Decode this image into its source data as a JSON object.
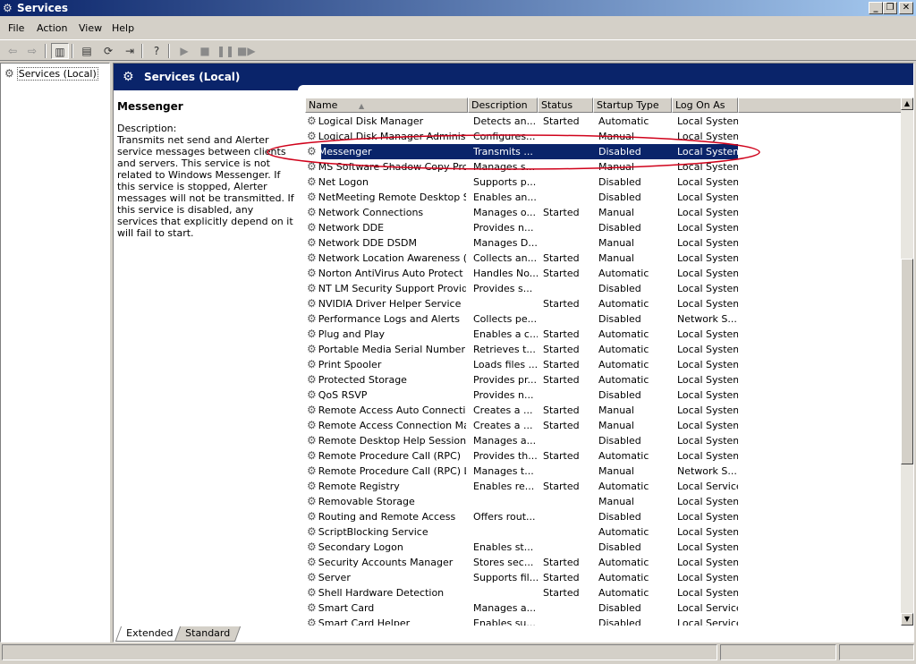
{
  "window": {
    "title": "Services",
    "min_glyph": "_",
    "max_glyph": "❐",
    "close_glyph": "✕"
  },
  "menu": [
    {
      "label": "File",
      "name": "menu-file"
    },
    {
      "label": "Action",
      "name": "menu-action"
    },
    {
      "label": "View",
      "name": "menu-view"
    },
    {
      "label": "Help",
      "name": "menu-help"
    }
  ],
  "toolbar": {
    "back_icon": "back-arrow-icon",
    "forward_icon": "forward-arrow-icon",
    "showhide_tree_icon": "show-hide-tree-icon",
    "properties_icon": "properties-icon",
    "refresh_icon": "refresh-icon",
    "export_icon": "export-list-icon",
    "help_icon": "help-icon",
    "start_icon": "start-service-icon",
    "stop_icon": "stop-service-icon",
    "pause_icon": "pause-service-icon",
    "restart_icon": "restart-service-icon"
  },
  "tree": {
    "item_label": "Services (Local)"
  },
  "pane_header": {
    "title": "Services (Local)"
  },
  "description_pane": {
    "service_name": "Messenger",
    "label": "Description:",
    "text": "Transmits net send and Alerter service messages between clients and servers. This service is not related to Windows Messenger. If this service is stopped, Alerter messages will not be transmitted. If this service is disabled, any services that explicitly depend on it will fail to start."
  },
  "columns": {
    "name": "Name",
    "sort_glyph": "▲",
    "description": "Description",
    "status": "Status",
    "startup_type": "Startup Type",
    "log_on_as": "Log On As"
  },
  "selected_row_index": 2,
  "annotation_color": "#d0021b",
  "selection_color": "#0a246a",
  "rows": [
    {
      "name": "Logical Disk Manager",
      "description": "Detects an...",
      "status": "Started",
      "startup": "Automatic",
      "logon": "Local System"
    },
    {
      "name": "Logical Disk Manager Administr...",
      "description": "Configures...",
      "status": "",
      "startup": "Manual",
      "logon": "Local System"
    },
    {
      "name": "Messenger",
      "description": "Transmits ...",
      "status": "",
      "startup": "Disabled",
      "logon": "Local System"
    },
    {
      "name": "MS Software Shadow Copy Pro...",
      "description": "Manages s...",
      "status": "",
      "startup": "Manual",
      "logon": "Local System"
    },
    {
      "name": "Net Logon",
      "description": "Supports p...",
      "status": "",
      "startup": "Disabled",
      "logon": "Local System"
    },
    {
      "name": "NetMeeting Remote Desktop S...",
      "description": "Enables an...",
      "status": "",
      "startup": "Disabled",
      "logon": "Local System"
    },
    {
      "name": "Network Connections",
      "description": "Manages o...",
      "status": "Started",
      "startup": "Manual",
      "logon": "Local System"
    },
    {
      "name": "Network DDE",
      "description": "Provides n...",
      "status": "",
      "startup": "Disabled",
      "logon": "Local System"
    },
    {
      "name": "Network DDE DSDM",
      "description": "Manages D...",
      "status": "",
      "startup": "Manual",
      "logon": "Local System"
    },
    {
      "name": "Network Location Awareness (...",
      "description": "Collects an...",
      "status": "Started",
      "startup": "Manual",
      "logon": "Local System"
    },
    {
      "name": "Norton AntiVirus Auto Protect ...",
      "description": "Handles No...",
      "status": "Started",
      "startup": "Automatic",
      "logon": "Local System"
    },
    {
      "name": "NT LM Security Support Provider",
      "description": "Provides s...",
      "status": "",
      "startup": "Disabled",
      "logon": "Local System"
    },
    {
      "name": "NVIDIA Driver Helper Service",
      "description": "",
      "status": "Started",
      "startup": "Automatic",
      "logon": "Local System"
    },
    {
      "name": "Performance Logs and Alerts",
      "description": "Collects pe...",
      "status": "",
      "startup": "Disabled",
      "logon": "Network S..."
    },
    {
      "name": "Plug and Play",
      "description": "Enables a c...",
      "status": "Started",
      "startup": "Automatic",
      "logon": "Local System"
    },
    {
      "name": "Portable Media Serial Number",
      "description": "Retrieves t...",
      "status": "Started",
      "startup": "Automatic",
      "logon": "Local System"
    },
    {
      "name": "Print Spooler",
      "description": "Loads files ...",
      "status": "Started",
      "startup": "Automatic",
      "logon": "Local System"
    },
    {
      "name": "Protected Storage",
      "description": "Provides pr...",
      "status": "Started",
      "startup": "Automatic",
      "logon": "Local System"
    },
    {
      "name": "QoS RSVP",
      "description": "Provides n...",
      "status": "",
      "startup": "Disabled",
      "logon": "Local System"
    },
    {
      "name": "Remote Access Auto Connectio...",
      "description": "Creates a ...",
      "status": "Started",
      "startup": "Manual",
      "logon": "Local System"
    },
    {
      "name": "Remote Access Connection Ma...",
      "description": "Creates a ...",
      "status": "Started",
      "startup": "Manual",
      "logon": "Local System"
    },
    {
      "name": "Remote Desktop Help Session ...",
      "description": "Manages a...",
      "status": "",
      "startup": "Disabled",
      "logon": "Local System"
    },
    {
      "name": "Remote Procedure Call (RPC)",
      "description": "Provides th...",
      "status": "Started",
      "startup": "Automatic",
      "logon": "Local System"
    },
    {
      "name": "Remote Procedure Call (RPC) L...",
      "description": "Manages t...",
      "status": "",
      "startup": "Manual",
      "logon": "Network S..."
    },
    {
      "name": "Remote Registry",
      "description": "Enables re...",
      "status": "Started",
      "startup": "Automatic",
      "logon": "Local Service"
    },
    {
      "name": "Removable Storage",
      "description": "",
      "status": "",
      "startup": "Manual",
      "logon": "Local System"
    },
    {
      "name": "Routing and Remote Access",
      "description": "Offers rout...",
      "status": "",
      "startup": "Disabled",
      "logon": "Local System"
    },
    {
      "name": "ScriptBlocking Service",
      "description": "",
      "status": "",
      "startup": "Automatic",
      "logon": "Local System"
    },
    {
      "name": "Secondary Logon",
      "description": "Enables st...",
      "status": "",
      "startup": "Disabled",
      "logon": "Local System"
    },
    {
      "name": "Security Accounts Manager",
      "description": "Stores sec...",
      "status": "Started",
      "startup": "Automatic",
      "logon": "Local System"
    },
    {
      "name": "Server",
      "description": "Supports fil...",
      "status": "Started",
      "startup": "Automatic",
      "logon": "Local System"
    },
    {
      "name": "Shell Hardware Detection",
      "description": "",
      "status": "Started",
      "startup": "Automatic",
      "logon": "Local System"
    },
    {
      "name": "Smart Card",
      "description": "Manages a...",
      "status": "",
      "startup": "Disabled",
      "logon": "Local Service"
    },
    {
      "name": "Smart Card Helper",
      "description": "Enables su...",
      "status": "",
      "startup": "Disabled",
      "logon": "Local Service"
    }
  ],
  "tabs": [
    {
      "label": "Extended",
      "active": true
    },
    {
      "label": "Standard",
      "active": false
    }
  ]
}
